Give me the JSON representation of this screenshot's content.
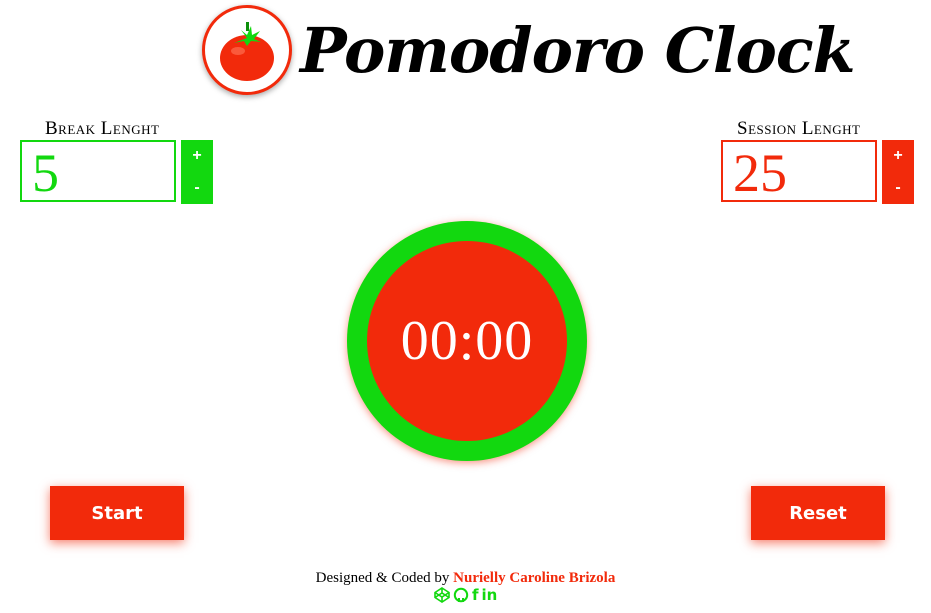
{
  "header": {
    "title": "Pomodoro Clock",
    "logo_icon": "tomato-icon"
  },
  "break": {
    "label": "Break Lenght",
    "value": "5",
    "plus": "+",
    "minus": "-",
    "color": "#12d80f"
  },
  "session": {
    "label": "Session Lenght",
    "value": "25",
    "plus": "+",
    "minus": "-",
    "color": "#f22a0b"
  },
  "timer": {
    "display": "00:00"
  },
  "controls": {
    "start_label": "Start",
    "reset_label": "Reset"
  },
  "footer": {
    "prefix": "Designed & Coded by ",
    "author": "Nurielly Caroline Brizola",
    "icons": [
      "codepen-icon",
      "github-icon",
      "facebook-icon",
      "linkedin-icon"
    ],
    "facebook_glyph": "f",
    "linkedin_glyph": "in"
  },
  "colors": {
    "accent_red": "#f22a0b",
    "accent_green": "#12d80f"
  }
}
